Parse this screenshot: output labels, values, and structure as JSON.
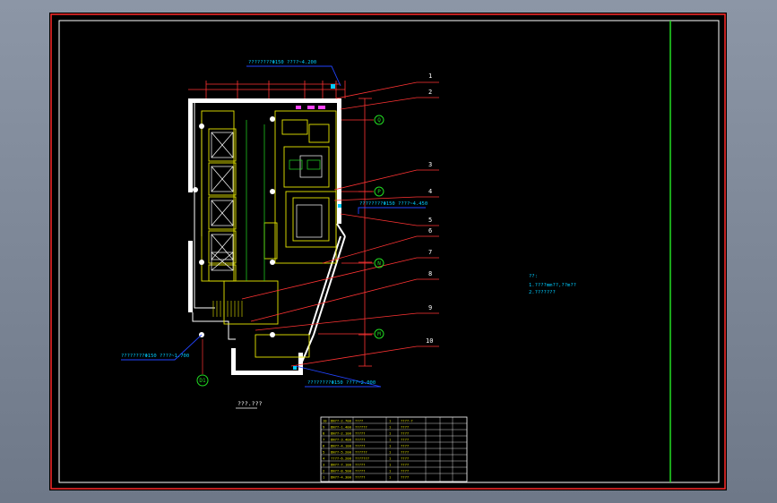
{
  "view": {
    "background_color": "#000000",
    "outer_background": "#7c8696"
  },
  "colors": {
    "frame_red": "#ff2a2a",
    "frame_white": "#ffffff",
    "green": "#22dd22",
    "yellow": "#e6e600",
    "cyan": "#00ccff",
    "blue": "#2244ff",
    "magenta": "#ff44ff"
  },
  "leaders": {
    "top_left_label": "????????Φ150 ????~4.200",
    "mid_right_label": "????????Φ150 ????~4.450",
    "bottom_left_label": "????????Φ150 ????~1.700",
    "bottom_right_label": "????????Φ150 ????~2.000",
    "numbers": [
      "1",
      "2",
      "3",
      "4",
      "5",
      "6",
      "7",
      "8",
      "9",
      "10"
    ]
  },
  "axes": {
    "q": "Q",
    "p": "P",
    "n": "N",
    "m": "M",
    "d1": "D1"
  },
  "plan_title": "???.???",
  "notes": {
    "heading": "??:",
    "line1": "1.????mm??,??m??",
    "line2": "2.???????"
  },
  "equipment_table": {
    "rows": [
      [
        "10",
        "DN??-2.700",
        "????",
        "1",
        "????-?"
      ],
      [
        "9",
        "DN??-1.400",
        "??????",
        "1",
        "????"
      ],
      [
        "8",
        "DN??-2.100",
        "?????",
        "1",
        "????"
      ],
      [
        "7",
        "DN??-3.400",
        "?????",
        "1",
        "????"
      ],
      [
        "6",
        "DN??-4.100",
        "?????",
        "1",
        "????"
      ],
      [
        "5",
        "DN??-5.200",
        "??????",
        "1",
        "????"
      ],
      [
        "4",
        "????-6.200",
        "???????",
        "1",
        "????"
      ],
      [
        "3",
        "DN??-7.100",
        "?????",
        "1",
        "????"
      ],
      [
        "2",
        "DN??-8.500",
        "?????",
        "1",
        "????"
      ],
      [
        "1",
        "DN??-4.300",
        "?????",
        "1",
        "????"
      ]
    ]
  }
}
